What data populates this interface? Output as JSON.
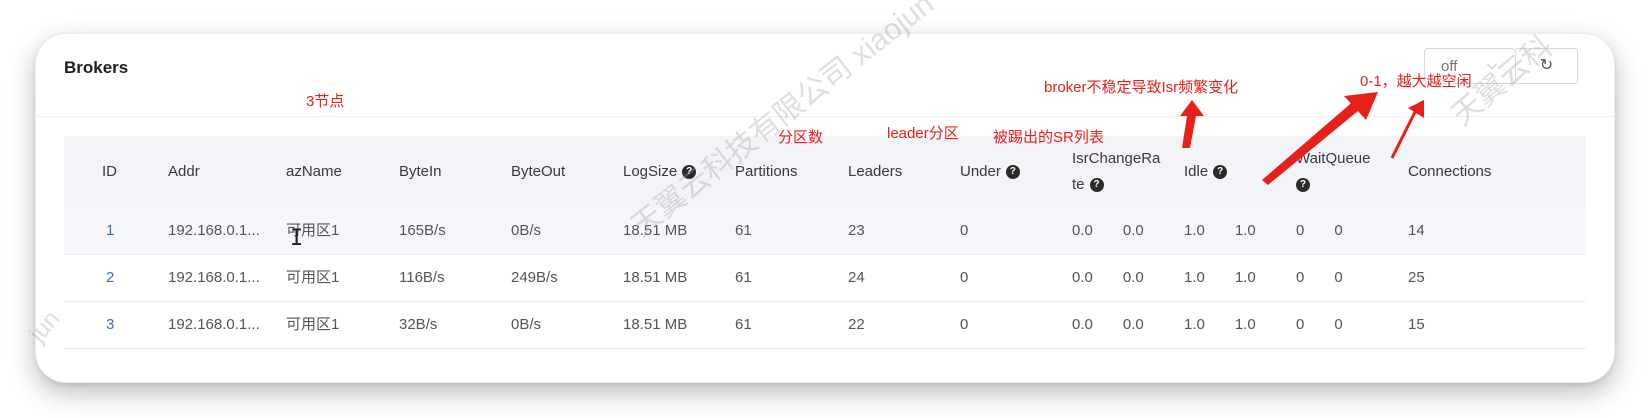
{
  "card": {
    "title": "Brokers",
    "refresh_value": "off",
    "refresh_icon": "refresh-icon"
  },
  "table": {
    "headers": [
      "ID",
      "Addr",
      "azName",
      "ByteIn",
      "ByteOut",
      "LogSize",
      "Partitions",
      "Leaders",
      "Under",
      "IsrChangeRa te",
      "Idle",
      "WaitQueue",
      "Connections"
    ],
    "rows": [
      {
        "id": "1",
        "addr": "192.168.0.1...",
        "az": "可用区1",
        "byte_in": "165B/s",
        "byte_out": "0B/s",
        "log_size": "18.51 MB",
        "partitions": "61",
        "leaders": "23",
        "under": "0",
        "isr_a": "0.0",
        "isr_b": "0.0",
        "idle_a": "1.0",
        "idle_b": "1.0",
        "wait_a": "0",
        "wait_b": "0",
        "connections": "14"
      },
      {
        "id": "2",
        "addr": "192.168.0.1...",
        "az": "可用区1",
        "byte_in": "116B/s",
        "byte_out": "249B/s",
        "log_size": "18.51 MB",
        "partitions": "61",
        "leaders": "24",
        "under": "0",
        "isr_a": "0.0",
        "isr_b": "0.0",
        "idle_a": "1.0",
        "idle_b": "1.0",
        "wait_a": "0",
        "wait_b": "0",
        "connections": "25"
      },
      {
        "id": "3",
        "addr": "192.168.0.1...",
        "az": "可用区1",
        "byte_in": "32B/s",
        "byte_out": "0B/s",
        "log_size": "18.51 MB",
        "partitions": "61",
        "leaders": "22",
        "under": "0",
        "isr_a": "0.0",
        "isr_b": "0.0",
        "idle_a": "1.0",
        "idle_b": "1.0",
        "wait_a": "0",
        "wait_b": "0",
        "connections": "15"
      }
    ]
  },
  "annotations": {
    "nodes": "3节点",
    "partitions": "分区数",
    "leaders": "leader分区",
    "under": "被踢出的SR列表",
    "isr": "broker不稳定导致Isr频繁变化",
    "idle": "0-1，越大越空闲",
    "color": "#e8201a"
  },
  "watermark": {
    "center": "天翼云科技有限公司 xiaojun",
    "right": "天翼云科",
    "left": "jun"
  }
}
